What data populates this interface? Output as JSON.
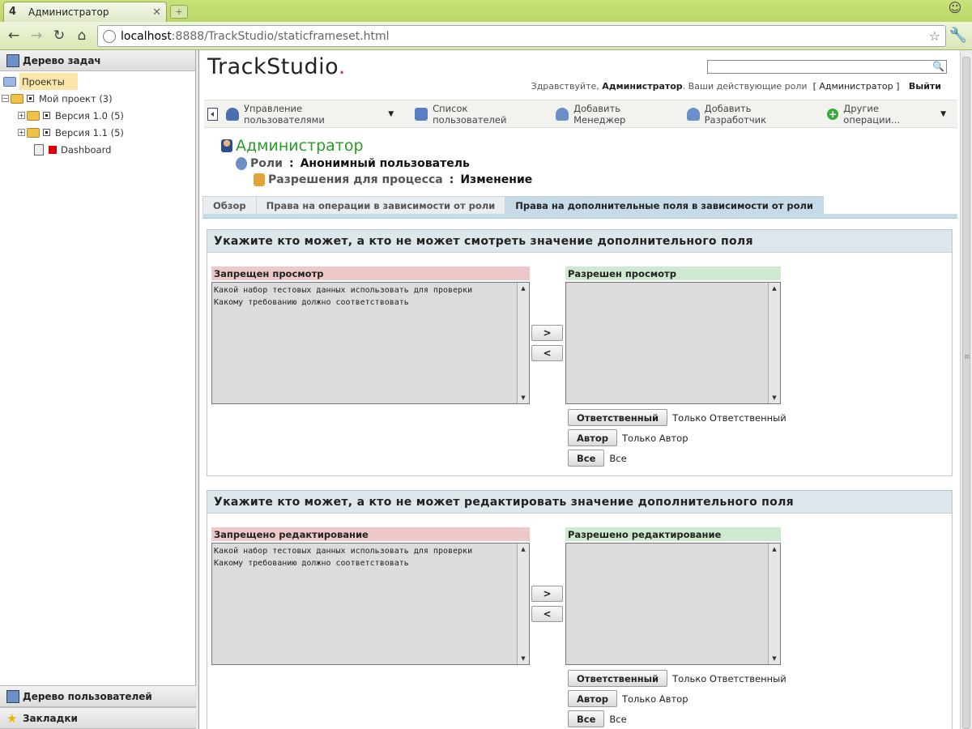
{
  "browser": {
    "tab_title": "Администратор",
    "url_host": "localhost",
    "url_rest": ":8888/TrackStudio/staticframeset.html"
  },
  "left": {
    "task_tree_title": "Дерево задач",
    "tree": {
      "root": "Проекты",
      "project": "Мой проект (3)",
      "v10": "Версия 1.0 (5)",
      "v11": "Версия 1.1 (5)",
      "dashboard": "Dashboard"
    },
    "users_tree_title": "Дерево пользователей",
    "bookmarks_title": "Закладки"
  },
  "header": {
    "logo": "TrackStudio",
    "logo_dot": ".",
    "greeting_prefix": "Здравствуйте,",
    "user": "Администратор",
    "roles_prefix": ". Ваши действующие роли",
    "roles_value": "[ Администратор ]",
    "exit": "Выйти"
  },
  "ops": {
    "manage_users": "Управление пользователями",
    "user_list": "Список пользователей",
    "add_manager": "Добавить Менеджер",
    "add_developer": "Добавить Разработчик",
    "other_ops": "Другие операции..."
  },
  "crumbs": {
    "title": "Администратор",
    "roles_label": "Роли",
    "roles_value": "Анонимный пользователь",
    "perm_label": "Разрешения для процесса",
    "perm_value": "Изменение",
    "sep": ":"
  },
  "tabs": {
    "overview": "Обзор",
    "ops_rights": "Права на операции в зависимости от роли",
    "fields_rights": "Права на дополнительные поля в зависимости от роли"
  },
  "view_section": {
    "title": "Укажите кто может, а кто не может смотреть значение дополнительного поля",
    "deny_label": "Запрещен просмотр",
    "allow_label": "Разрешен просмотр",
    "deny_items": [
      "Какой набор тестовых данных использовать для проверки",
      "Какому требованию должно соответствовать"
    ],
    "move_right": ">",
    "move_left": "<",
    "responsible_btn": "Ответственный",
    "responsible_text": "Только Ответственный",
    "author_btn": "Автор",
    "author_text": "Только Автор",
    "all_btn": "Все",
    "all_text": "Все"
  },
  "edit_section": {
    "title": "Укажите кто может, а кто не может редактировать значение дополнительного поля",
    "deny_label": "Запрещено редактирование",
    "allow_label": "Разрешено редактирование",
    "deny_items": [
      "Какой набор тестовых данных использовать для проверки",
      "Какому требованию должно соответствовать"
    ],
    "move_right": ">",
    "move_left": "<",
    "responsible_btn": "Ответственный",
    "responsible_text": "Только Ответственный",
    "author_btn": "Автор",
    "author_text": "Только Автор",
    "all_btn": "Все",
    "all_text": "Все"
  }
}
